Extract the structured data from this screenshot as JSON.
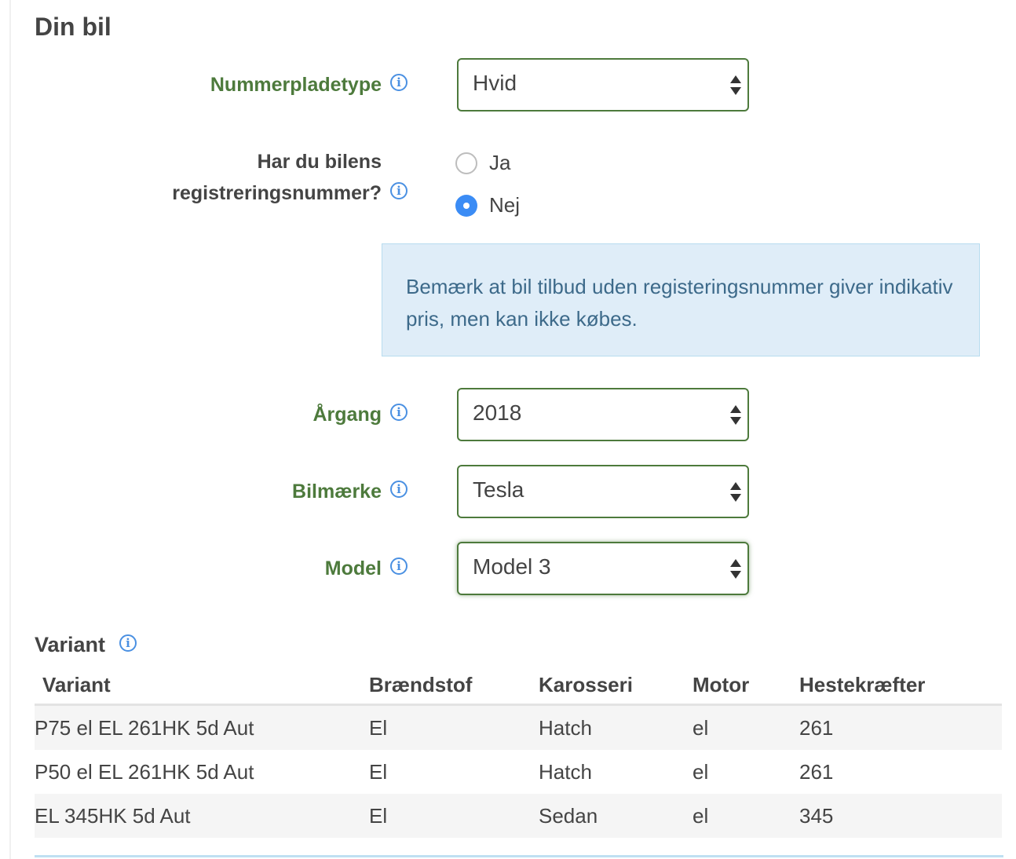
{
  "section": {
    "title": "Din bil"
  },
  "plate_type": {
    "label": "Nummerpladetype",
    "value": "Hvid"
  },
  "registration": {
    "label_line1": "Har du bilens",
    "label_line2": "registreringsnummer?",
    "options": [
      {
        "label": "Ja",
        "checked": false
      },
      {
        "label": "Nej",
        "checked": true
      }
    ]
  },
  "notice": {
    "text": "Bemærk at bil tilbud uden registeringsnummer giver indikativ pris, men kan ikke købes."
  },
  "year": {
    "label": "Årgang",
    "value": "2018"
  },
  "brand": {
    "label": "Bilmærke",
    "value": "Tesla"
  },
  "model": {
    "label": "Model",
    "value": "Model 3"
  },
  "variant": {
    "title": "Variant",
    "columns": [
      "Variant",
      "Brændstof",
      "Karosseri",
      "Motor",
      "Hestekræfter"
    ],
    "rows": [
      [
        "P75 el EL 261HK 5d Aut",
        "El",
        "Hatch",
        "el",
        "261"
      ],
      [
        "P50 el EL 261HK 5d Aut",
        "El",
        "Hatch",
        "el",
        "261"
      ],
      [
        "EL 345HK 5d Aut",
        "El",
        "Sedan",
        "el",
        "345"
      ]
    ]
  },
  "icons": {
    "info": "info-icon",
    "select_arrows": "updown-arrows-icon"
  },
  "colors": {
    "label_green": "#4d7a3c",
    "radio_blue": "#3b8cf5",
    "notice_bg": "#dfedf8",
    "info_blue": "#4a90e2"
  }
}
